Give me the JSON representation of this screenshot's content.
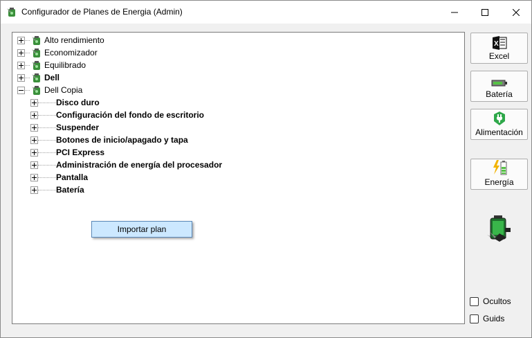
{
  "window": {
    "title": "Configurador de Planes de Energia (Admin)",
    "controls": [
      "minimize-icon",
      "maximize-icon",
      "close-icon"
    ]
  },
  "tree": {
    "plans": [
      {
        "label": "Alto rendimiento",
        "bold": false
      },
      {
        "label": "Economizador",
        "bold": false
      },
      {
        "label": "Equilibrado",
        "bold": false
      },
      {
        "label": "Dell",
        "bold": true
      },
      {
        "label": "Dell Copia",
        "bold": false,
        "expanded": true
      }
    ],
    "subgroups": [
      "Disco duro",
      "Configuración del fondo de escritorio",
      "Suspender",
      "Botones de inicio/apagado y tapa",
      "PCI Express",
      "Administración de energía del procesador",
      "Pantalla",
      "Batería"
    ]
  },
  "context_menu": {
    "item": "Importar plan"
  },
  "side_buttons": [
    {
      "label": "Excel",
      "icon": "excel-icon"
    },
    {
      "label": "Batería",
      "icon": "battery-icon"
    },
    {
      "label": "Alimentación",
      "icon": "power-plug-icon"
    },
    {
      "label": "Energía",
      "icon": "energy-icon"
    }
  ],
  "checkboxes": [
    {
      "label": "Ocultos",
      "checked": false
    },
    {
      "label": "Guids",
      "checked": false
    }
  ],
  "colors": {
    "selection": "#cce8ff",
    "window_bg": "#f0f0f0",
    "accent_green": "#3aa54a"
  }
}
